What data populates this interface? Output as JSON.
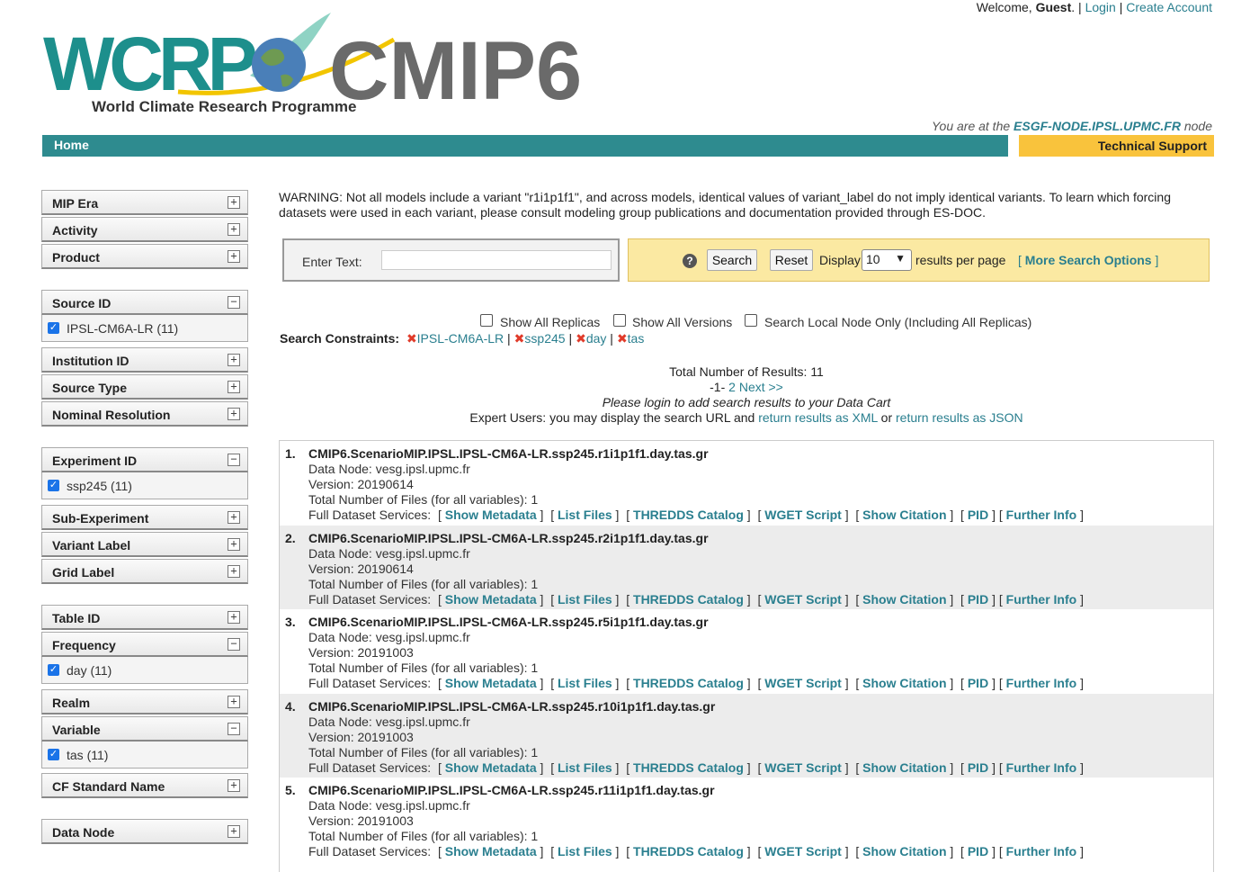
{
  "header": {
    "welcome_prefix": "Welcome, ",
    "user": "Guest",
    "login": "Login",
    "create_account": "Create Account",
    "wcrp_text": "WCRP",
    "wcrp_subtitle": "World Climate Research Programme",
    "cmip6_text": "CMIP6",
    "node_prefix": "You are at the ",
    "node_name": "ESGF-NODE.IPSL.UPMC.FR",
    "node_suffix": " node",
    "home": "Home",
    "tech_support": "Technical Support"
  },
  "facets": {
    "mip_era": "MIP Era",
    "activity": "Activity",
    "product": "Product",
    "source_id": "Source ID",
    "source_id_opt": "IPSL-CM6A-LR (11)",
    "institution_id": "Institution ID",
    "source_type": "Source Type",
    "nominal_resolution": "Nominal Resolution",
    "experiment_id": "Experiment ID",
    "experiment_id_opt": "ssp245 (11)",
    "sub_experiment": "Sub-Experiment",
    "variant_label": "Variant Label",
    "grid_label": "Grid Label",
    "table_id": "Table ID",
    "frequency": "Frequency",
    "frequency_opt": "day (11)",
    "realm": "Realm",
    "variable": "Variable",
    "variable_opt": "tas (11)",
    "cf_standard_name": "CF Standard Name",
    "data_node": "Data Node",
    "expand_symbol": "+",
    "collapse_symbol": "−"
  },
  "warning": "WARNING: Not all models include a variant \"r1i1p1f1\", and across models, identical values of variant_label do not imply identical variants. To learn which forcing datasets were used in each variant, please consult modeling group publications and documentation provided through ES-DOC.",
  "search": {
    "enter_text_label": "Enter Text:",
    "input_value": "",
    "help": "?",
    "search_button": "Search",
    "reset_button": "Reset",
    "display_label": "Display",
    "display_value": "10",
    "per_page": "results per page",
    "more_options": "More Search Options",
    "show_all_replicas": "Show All Replicas",
    "show_all_versions": "Show All Versions",
    "local_node_only": "Search Local Node Only (Including All Replicas)"
  },
  "constraints": {
    "label": "Search Constraints:",
    "items": [
      "IPSL-CM6A-LR",
      "ssp245",
      "day",
      "tas"
    ]
  },
  "summary": {
    "total_results": "Total Number of Results: 11",
    "page_current": "-1-",
    "page_next": "2 Next >>",
    "login_note": "Please login to add search results to your Data Cart",
    "expert_prefix": "Expert Users: you may display the search URL and ",
    "xml_link": "return results as XML",
    "or_text": " or ",
    "json_link": "return results as JSON"
  },
  "services": {
    "label": "Full Dataset Services:",
    "show_metadata": "Show Metadata",
    "list_files": "List Files",
    "thredds": "THREDDS Catalog",
    "wget": "WGET Script",
    "citation": "Show Citation",
    "pid": "PID",
    "further_info": "Further Info"
  },
  "results": [
    {
      "num": "1.",
      "title": "CMIP6.ScenarioMIP.IPSL.IPSL-CM6A-LR.ssp245.r1i1p1f1.day.tas.gr",
      "data_node": "Data Node: vesg.ipsl.upmc.fr",
      "version": "Version: 20190614",
      "files": "Total Number of Files (for all variables): 1"
    },
    {
      "num": "2.",
      "title": "CMIP6.ScenarioMIP.IPSL.IPSL-CM6A-LR.ssp245.r2i1p1f1.day.tas.gr",
      "data_node": "Data Node: vesg.ipsl.upmc.fr",
      "version": "Version: 20190614",
      "files": "Total Number of Files (for all variables): 1"
    },
    {
      "num": "3.",
      "title": "CMIP6.ScenarioMIP.IPSL.IPSL-CM6A-LR.ssp245.r5i1p1f1.day.tas.gr",
      "data_node": "Data Node: vesg.ipsl.upmc.fr",
      "version": "Version: 20191003",
      "files": "Total Number of Files (for all variables): 1"
    },
    {
      "num": "4.",
      "title": "CMIP6.ScenarioMIP.IPSL.IPSL-CM6A-LR.ssp245.r10i1p1f1.day.tas.gr",
      "data_node": "Data Node: vesg.ipsl.upmc.fr",
      "version": "Version: 20191003",
      "files": "Total Number of Files (for all variables): 1"
    },
    {
      "num": "5.",
      "title": "CMIP6.ScenarioMIP.IPSL.IPSL-CM6A-LR.ssp245.r11i1p1f1.day.tas.gr",
      "data_node": "Data Node: vesg.ipsl.upmc.fr",
      "version": "Version: 20191003",
      "files": "Total Number of Files (for all variables): 1"
    }
  ]
}
